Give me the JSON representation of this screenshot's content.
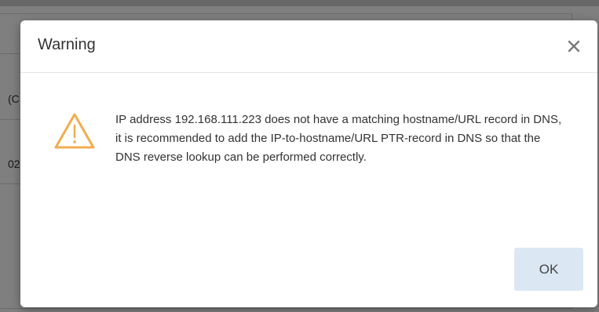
{
  "background": {
    "fragment_1": "(C",
    "fragment_2": "02"
  },
  "dialog": {
    "title": "Warning",
    "close_glyph": "×",
    "icon": "warning-triangle-icon",
    "icon_color": "#f0ad4e",
    "message": "IP address 192.168.111.223 does not have a matching hostname/URL record in DNS, it is recommended to add the IP-to-hostname/URL PTR-record in DNS so that the DNS reverse lookup can be performed correctly.",
    "ok_label": "OK",
    "ok_color": "#dbe8f4"
  }
}
